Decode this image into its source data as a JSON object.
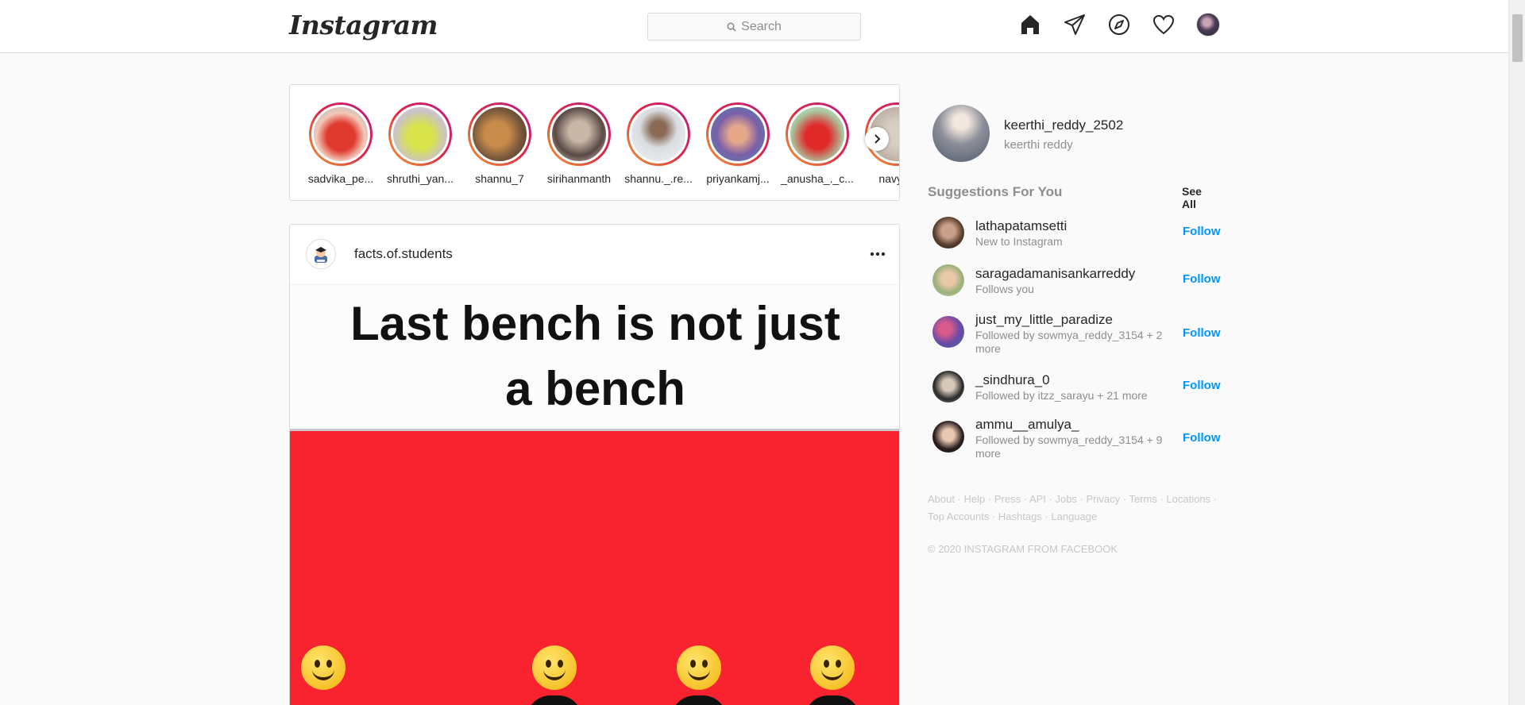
{
  "header": {
    "logo": "Instagram",
    "search_placeholder": "Search",
    "nav_icons": [
      "home-icon",
      "direct-icon",
      "explore-icon",
      "activity-icon",
      "profile-avatar"
    ]
  },
  "stories": [
    {
      "username": "sadvika_pe..."
    },
    {
      "username": "shruthi_yan..."
    },
    {
      "username": "shannu_7"
    },
    {
      "username": "sirihanmanth"
    },
    {
      "username": "shannu._.re..."
    },
    {
      "username": "priyankamj..."
    },
    {
      "username": "_anusha_._c..."
    },
    {
      "username": "navya_"
    }
  ],
  "post": {
    "username": "facts.of.students",
    "image_text_line1": "Last bench is not just",
    "image_text_line2": "a bench"
  },
  "profile": {
    "username": "keerthi_reddy_2502",
    "name": "keerthi reddy"
  },
  "suggestions": {
    "title": "Suggestions For You",
    "see_all": "See All",
    "follow_label": "Follow",
    "items": [
      {
        "username": "lathapatamsetti",
        "subtitle": "New to Instagram"
      },
      {
        "username": "saragadamanisankarreddy",
        "subtitle": "Follows you"
      },
      {
        "username": "just_my_little_paradize",
        "subtitle": "Followed by sowmya_reddy_3154 + 2 more"
      },
      {
        "username": "_sindhura_0",
        "subtitle": "Followed by itzz_sarayu + 21 more"
      },
      {
        "username": "ammu__amulya_",
        "subtitle": "Followed by sowmya_reddy_3154 + 9 more"
      }
    ]
  },
  "footer": {
    "links": [
      "About",
      "Help",
      "Press",
      "API",
      "Jobs",
      "Privacy",
      "Terms",
      "Locations",
      "Top Accounts",
      "Hashtags",
      "Language"
    ],
    "copyright": "© 2020 INSTAGRAM FROM FACEBOOK"
  },
  "colors": {
    "accent_blue": "#0095f6",
    "story_ring_start": "#f09433",
    "story_ring_end": "#bc1888",
    "muted_text": "#8e8e8e"
  }
}
